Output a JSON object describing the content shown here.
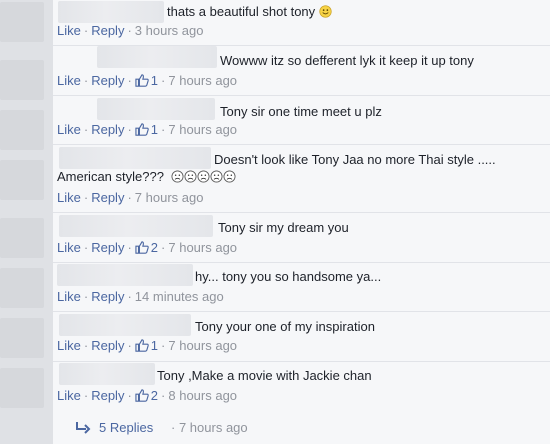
{
  "actions": {
    "like": "Like",
    "reply": "Reply",
    "dot": "·"
  },
  "comments": [
    {
      "text": "thats a beautiful shot tony",
      "emoji": "smile-emoji",
      "time": "3 hours ago"
    },
    {
      "text": "Wowww itz so defferent lyk it keep it up tony",
      "likes": "1",
      "time": "7 hours ago"
    },
    {
      "text": "Tony sir one time meet u plz",
      "likes": "1",
      "time": "7 hours ago"
    },
    {
      "text": "Doesn't look like Tony Jaa no more Thai style .....",
      "text2": "American style???",
      "emoji_count": 5,
      "time": "7 hours ago"
    },
    {
      "text": "Tony sir my dream you",
      "likes": "2",
      "time": "7 hours ago"
    },
    {
      "text": "hy... tony you so handsome ya...",
      "time": "14 minutes ago"
    },
    {
      "text": "Tony your one of my inspiration",
      "likes": "1",
      "time": "7 hours ago"
    },
    {
      "text": "Tony ,Make a movie with Jackie chan",
      "likes": "2",
      "time": "8 hours ago"
    }
  ],
  "replies": {
    "label": "5 Replies",
    "time": "7 hours ago"
  },
  "colors": {
    "link": "#4b67a1",
    "meta": "#90949c",
    "background": "#f6f7f9"
  }
}
